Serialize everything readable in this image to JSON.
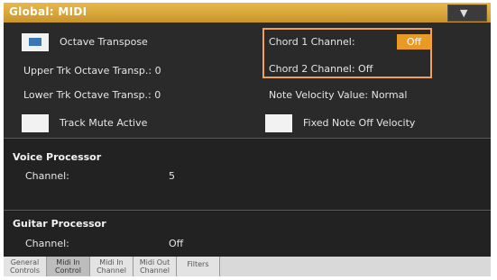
{
  "window": {
    "title": "Global: MIDI",
    "menu_icon": "chevron-down"
  },
  "options": {
    "octave_transpose_label": "Octave Transpose",
    "octave_transpose_checked": true,
    "upper_trk_label": "Upper Trk Octave Transp.: 0",
    "lower_trk_label": "Lower Trk Octave Transp.: 0",
    "track_mute_label": "Track Mute Active",
    "track_mute_checked": false,
    "chord1_label": "Chord 1 Channel:",
    "chord1_value": "Off",
    "chord2_label": "Chord 2 Channel: Off",
    "note_velocity_label": "Note Velocity Value: Normal",
    "fixed_note_off_label": "Fixed Note Off Velocity",
    "fixed_note_off_checked": false
  },
  "voice_processor": {
    "title": "Voice Processor",
    "channel_label": "Channel:",
    "channel_value": "5"
  },
  "guitar_processor": {
    "title": "Guitar Processor",
    "channel_label": "Channel:",
    "channel_value": "Off"
  },
  "tabs": [
    {
      "line1": "General",
      "line2": "Controls",
      "active": false
    },
    {
      "line1": "Midi In",
      "line2": "Control",
      "active": true
    },
    {
      "line1": "Midi In",
      "line2": "Channel",
      "active": false
    },
    {
      "line1": "Midi Out",
      "line2": "Channel",
      "active": false
    },
    {
      "line1": "Filters",
      "line2": "",
      "active": false
    }
  ],
  "colors": {
    "title_bar": "#d9a33a",
    "highlight": "#e89a24",
    "annotation": "#f0a05a"
  }
}
